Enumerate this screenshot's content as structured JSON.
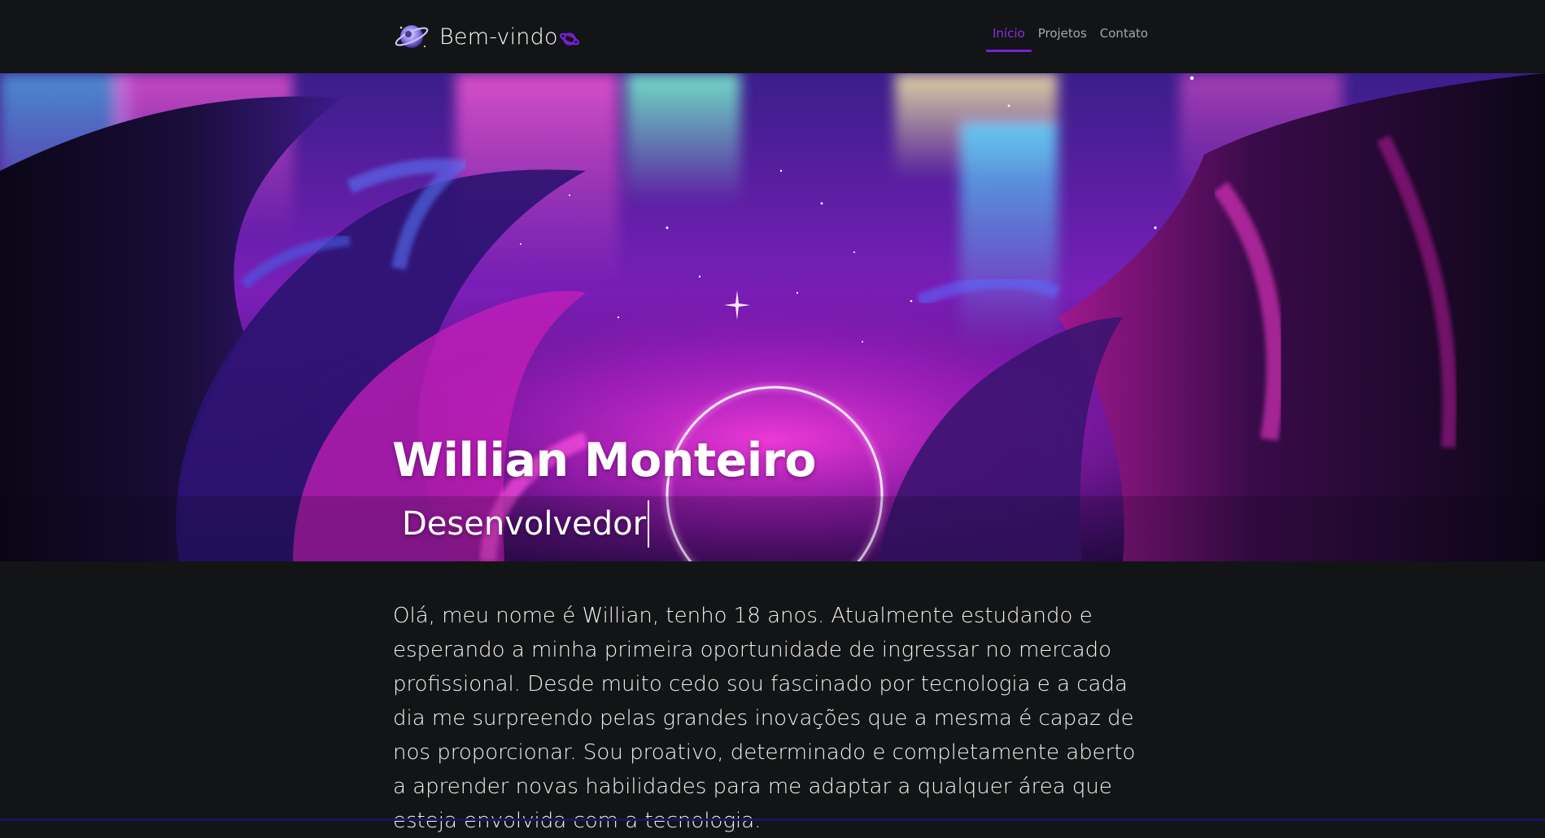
{
  "navbar": {
    "brand_text": "Bem-vindo",
    "brand_logo_icon": "astronaut-emoji-icon",
    "brand_suffix_icon": "ringed-planet-icon",
    "items": [
      {
        "label": "Início",
        "active": true
      },
      {
        "label": "Projetos",
        "active": false
      },
      {
        "label": "Contato",
        "active": false
      }
    ]
  },
  "hero": {
    "name": "Willian Monteiro",
    "role": "Desenvolvedor",
    "background": "aurora-cosmic-portal-image"
  },
  "about": {
    "text": "Olá, meu nome é Willian, tenho 18 anos. Atualmente estudando e esperando a minha primeira oportunidade de ingressar no mercado profissional. Desde muito cedo sou fascinado por tecnologia e a cada dia me surpreendo pelas grandes inovações que a mesma é capaz de nos proporcionar. Sou proativo, determinado e completamente aberto a aprender novas habilidades para me adaptar a qualquer área que esteja envolvida com a tecnologia."
  },
  "colors": {
    "background": "#131415",
    "accent": "#7a1fd8",
    "nav_text": "#a6a6ad",
    "text": "#ffffff"
  }
}
